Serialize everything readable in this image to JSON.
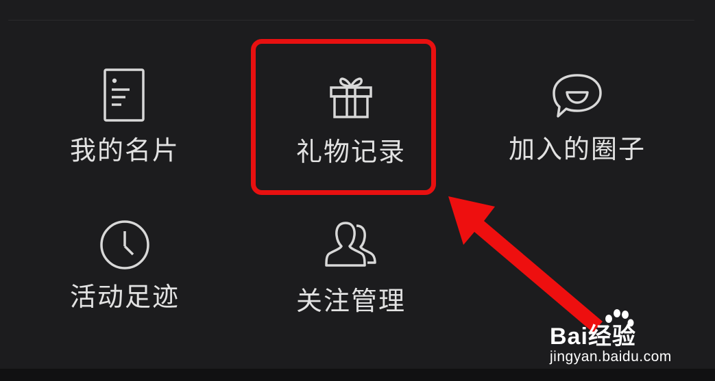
{
  "menu": {
    "items": [
      {
        "label": "我的名片",
        "icon": "business-card-icon"
      },
      {
        "label": "礼物记录",
        "icon": "gift-icon"
      },
      {
        "label": "加入的圈子",
        "icon": "chat-bubble-smile-icon"
      },
      {
        "label": "活动足迹",
        "icon": "clock-icon"
      },
      {
        "label": "关注管理",
        "icon": "users-icon"
      }
    ]
  },
  "annotation": {
    "highlight_color": "#e81010",
    "highlighted_item": "礼物记录"
  },
  "watermark": {
    "brand": "Bai经验",
    "url": "jingyan.baidu.com"
  },
  "colors": {
    "background": "#1c1c1e",
    "icon_stroke": "#d8d8d8",
    "label_text": "#e2e2e2"
  }
}
